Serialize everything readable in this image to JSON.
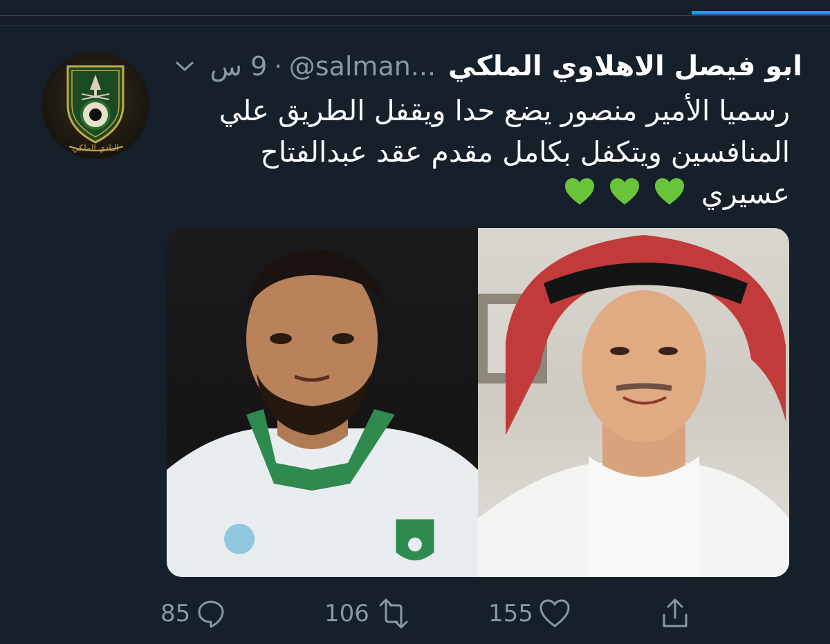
{
  "tweet": {
    "display_name": "ابو فيصل الاهلاوي الملكي",
    "handle": "@salman...",
    "separator": "·",
    "time": "9 س",
    "text": "رسميا الأمير منصور يضع حدا ويقفل الطريق علي المنافسين ويتكفل بكامل مقدم عقد عبدالفتاح عسيري",
    "hearts": [
      "💚",
      "💚",
      "💚"
    ],
    "avatar_icon": "club-crest",
    "media": [
      "player-photo",
      "prince-photo"
    ]
  },
  "actions": {
    "replies": "85",
    "retweets": "106",
    "likes": "155",
    "reply_icon": "reply-icon",
    "retweet_icon": "retweet-icon",
    "like_icon": "heart-icon",
    "share_icon": "share-icon"
  },
  "colors": {
    "background": "#15202b",
    "secondary_text": "#8899a6",
    "accent": "#1d9bf0",
    "heart_green": "#6ac43a"
  }
}
